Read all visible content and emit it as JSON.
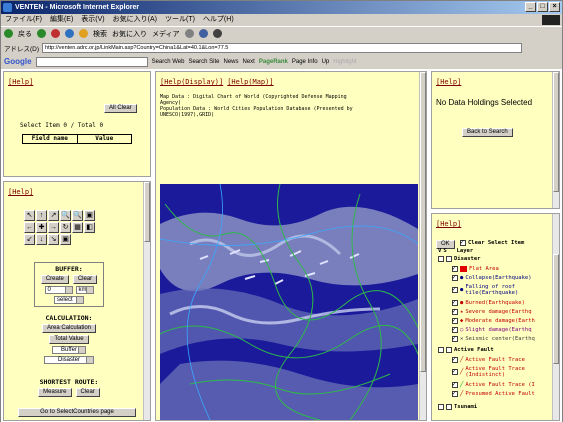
{
  "window": {
    "title": "VENTEN - Microsoft Internet Explorer",
    "controls": [
      "_",
      "□",
      "×"
    ]
  },
  "menu": [
    "ファイル(F)",
    "編集(E)",
    "表示(V)",
    "お気に入り(A)",
    "ツール(T)",
    "ヘルプ(H)"
  ],
  "toolbar": {
    "back": "戻る",
    "search": "検索",
    "favorites": "お気に入り",
    "media": "メディア"
  },
  "address": {
    "label": "アドレス(D)",
    "url": "http://venten.adrc.or.jp/LinkMain.asp?Country=China1&Lat=40.1&Lon=77.5"
  },
  "googlebar": {
    "logo": "Google",
    "search_web": "Search Web",
    "search_site": "Search Site",
    "news": "News",
    "next": "Next",
    "pagerank": "PageRank",
    "page_info": "Page Info",
    "up": "Up",
    "highlight": "Highlight"
  },
  "left_top": {
    "help": "[Help]",
    "all_clear": "All Clear",
    "select_item": "Select Item 0 / Total 0",
    "col_field": "Field name",
    "col_value": "Value"
  },
  "left_tools": {
    "help": "[Help]",
    "tool_icons": [
      "↖",
      "↑",
      "↗",
      "🔍",
      "🔍",
      "▣",
      "←",
      "✚",
      "→",
      "↻",
      "▦",
      "◧",
      "↙",
      "↓",
      "↘",
      "▣"
    ],
    "buffer_title": "BUFFER:",
    "create": "Create",
    "clear": "Clear",
    "buffer_value": "0",
    "buffer_unit": "km",
    "select_placeholder": "select",
    "calc_title": "CALCULATION:",
    "area_calc": "Area Calculation",
    "total_value": "Total Value",
    "buffer_opt": "Buffer",
    "disaster_opt": "Disaster",
    "shortest_title": "SHORTEST ROUTE:",
    "measure": "Measure",
    "clear2": "Clear",
    "goto": "Go to SelectCountries page"
  },
  "map": {
    "help_display": "[Help(Display)]",
    "help_map": "[Help(Map)]",
    "source_line1": "Map Data : Digital Chart of World (Copyrighted Defense Mapping",
    "source_line2": "Agency)",
    "source_line3": "Population Data : World Cities Population Database (Presented by",
    "source_line4": "UNESCO(1997),GRID)"
  },
  "right_top": {
    "help": "[Help]",
    "message": "No Data Holdings Selected",
    "back": "Back to Search"
  },
  "right_layers": {
    "help": "[Help]",
    "ok": "OK",
    "clear_select": "Clear Select Item",
    "col_v": "V",
    "col_s": "S",
    "col_layer": "Layer",
    "disaster": "Disaster",
    "items": [
      {
        "label": "Flat Area",
        "color": "#c00000",
        "on": true
      },
      {
        "label": "Collapse(Earthquake)",
        "color": "#000080",
        "on": true
      },
      {
        "label": "Falling of roof tile(Earthquake)",
        "color": "#000080",
        "on": true
      },
      {
        "label": "Burned(Earthquake)",
        "color": "#c00000",
        "on": true
      },
      {
        "label": "Severe damage(Earthq",
        "color": "#c00000",
        "on": true
      },
      {
        "label": "Moderate damage(Earth",
        "color": "#c00000",
        "on": true
      },
      {
        "label": "Slight damage(Earthq",
        "color": "#800080",
        "on": true
      },
      {
        "label": "Seismic center(Earthq",
        "color": "#404040",
        "on": true
      }
    ],
    "active_fault": "Active Fault",
    "fault_items": [
      {
        "label": "Active Fault Trace",
        "color": "#c00000"
      },
      {
        "label": "Active Fault Trace (Indistinct)",
        "color": "#c00000"
      },
      {
        "label": "Active Fault Trace (I",
        "color": "#00a000"
      },
      {
        "label": "Presumed Active Fault",
        "color": "#c00000"
      }
    ],
    "tsunami": "Tsunami"
  },
  "colors": {
    "panel": "#ffffc0",
    "map_bg": "#1a1a9a",
    "help_link": "#800000"
  }
}
